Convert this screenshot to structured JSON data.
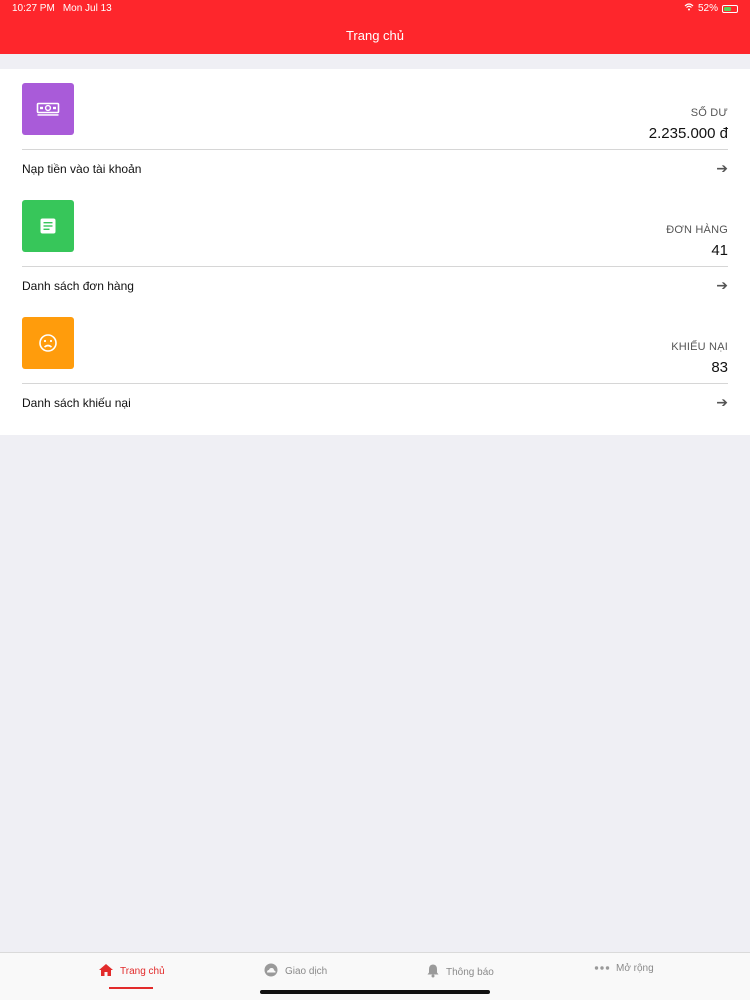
{
  "status_bar": {
    "time": "10:27 PM",
    "date": "Mon Jul 13",
    "battery": "52%",
    "icons": [
      "wifi-icon",
      "battery-icon"
    ]
  },
  "header": {
    "title": "Trang chủ",
    "background_color": "#fe262c"
  },
  "sections": [
    {
      "icon": "money-icon",
      "icon_color": "#a95bd9",
      "label": "SỐ DƯ",
      "value": "2.235.000 đ",
      "link": "Nạp tiền vào tài khoản"
    },
    {
      "icon": "document-icon",
      "icon_color": "#37c65a",
      "label": "ĐƠN HÀNG",
      "value": "41",
      "link": "Danh sách đơn hàng"
    },
    {
      "icon": "frown-icon",
      "icon_color": "#ff9c0c",
      "label": "KHIẾU NẠI",
      "value": "83",
      "link": "Danh sách khiếu nại"
    }
  ],
  "tabbar": {
    "active_color": "#e22b2b",
    "items": [
      {
        "label": "Trang chủ",
        "icon": "home-icon",
        "active": true
      },
      {
        "label": "Giao dịch",
        "icon": "cloud-icon",
        "active": false
      },
      {
        "label": "Thông báo",
        "icon": "bell-icon",
        "active": false
      },
      {
        "label": "Mở rộng",
        "icon": "more-icon",
        "active": false
      }
    ]
  }
}
